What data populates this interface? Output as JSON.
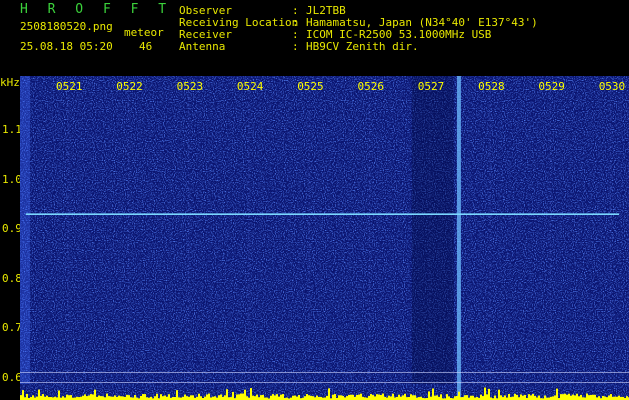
{
  "header": {
    "brand": "H R O F F T",
    "filename": "2508180520.png",
    "datetime": "25.08.18 05:20",
    "count_label": "meteor",
    "count_value": "46",
    "fields": [
      {
        "label": "Observer",
        "sep": ":",
        "value": "JL2TBB"
      },
      {
        "label": "Receiving Location",
        "sep": ":",
        "value": "Hamamatsu, Japan (N34°40' E137°43')"
      },
      {
        "label": "Receiver",
        "sep": ":",
        "value": "ICOM IC-R2500 53.1000MHz USB"
      },
      {
        "label": "Antenna",
        "sep": ":",
        "value": "HB9CV Zenith dir."
      }
    ]
  },
  "chart_data": {
    "type": "heatmap",
    "ylabel": "kHz",
    "yticks": [
      "1.1",
      "1.0",
      "0.9",
      "0.8",
      "0.7",
      "0.6"
    ],
    "xticks": [
      "0521",
      "0522",
      "0523",
      "0524",
      "0525",
      "0526",
      "0527",
      "0528",
      "0529",
      "0530"
    ],
    "colors": {
      "background": "#0a1470",
      "noise": "#2a52ff",
      "trace": "#7ad7ff",
      "spectrum": "#ffff00",
      "text": "#e8e800"
    },
    "meteor_trace": {
      "freq_khz": 0.93,
      "from": "0520.3",
      "to": "0530"
    },
    "reference_lines_khz": [
      0.62,
      0.6
    ]
  }
}
